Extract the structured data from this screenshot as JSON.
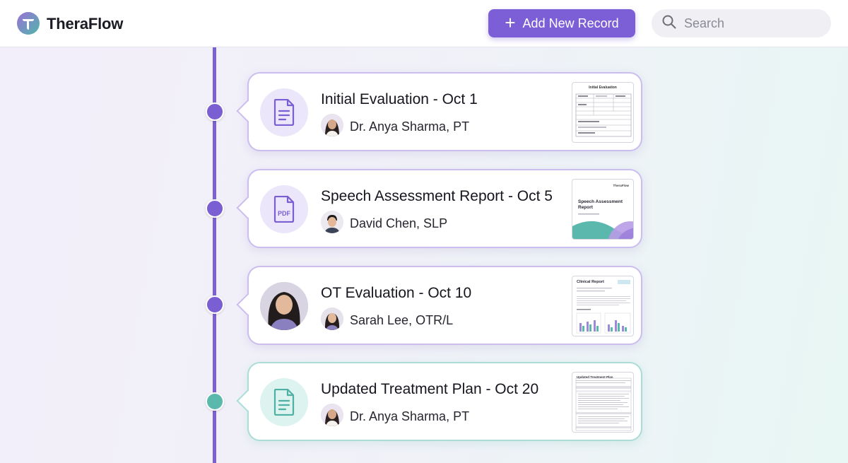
{
  "app": {
    "brand": "TheraFlow",
    "accent_color": "#7c5fd6",
    "secondary_color": "#5ab8ad"
  },
  "toolbar": {
    "add_label": "Add New Record",
    "add_icon": "plus-icon",
    "search_placeholder": "Search",
    "search_icon": "search-icon"
  },
  "records": [
    {
      "title": "Initial Evaluation - Oct 1",
      "author": "Dr. Anya Sharma, PT",
      "icon": "document-icon",
      "theme": "purple",
      "thumbnail": {
        "title": "Initial Evaluation"
      }
    },
    {
      "title": "Speech Assessment Report - Oct 5",
      "author": "David Chen, SLP",
      "icon": "pdf-icon",
      "theme": "purple",
      "thumbnail": {
        "brand": "TheraFlow",
        "title": "Speech Assessment Report"
      }
    },
    {
      "title": "OT Evaluation - Oct 10",
      "author": "Sarah Lee, OTR/L",
      "icon": "patient-photo",
      "theme": "purple",
      "thumbnail": {
        "title": "Clinical Report"
      }
    },
    {
      "title": "Updated Treatment Plan - Oct 20",
      "author": "Dr. Anya Sharma, PT",
      "icon": "document-icon",
      "theme": "teal",
      "thumbnail": {
        "title": "Updated Treatment Plan"
      }
    }
  ]
}
